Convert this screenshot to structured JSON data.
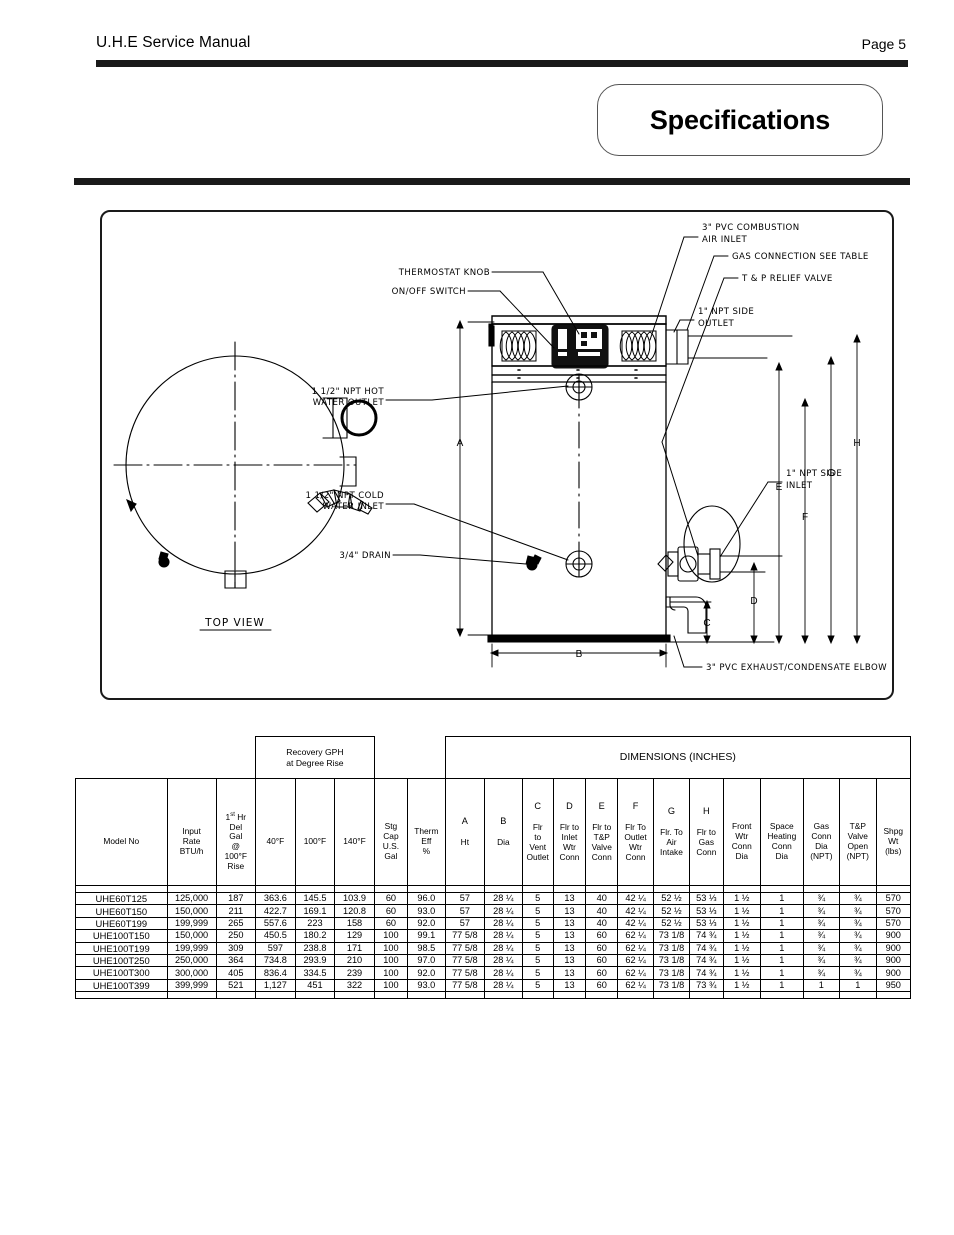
{
  "header": {
    "manual_title": "U.H.E Service Manual",
    "page_number": "Page 5",
    "section_badge": "Specifications"
  },
  "diagram": {
    "top_view_label": "TOP VIEW",
    "callouts": {
      "thermostat_knob": "THERMOSTAT KNOB",
      "on_off_switch": "ON/OFF SWITCH",
      "pvc_combustion_air_inlet_line1": "3\" PVC COMBUSTION",
      "pvc_combustion_air_inlet_line2": "AIR INLET",
      "gas_connection": "GAS CONNECTION SEE TABLE",
      "tp_relief_valve": "T & P RELIEF VALVE",
      "npt_side_outlet_line1": "1\" NPT SIDE",
      "npt_side_outlet_line2": "OUTLET",
      "npt_hot_water_outlet_line1": "1 1/2\" NPT HOT",
      "npt_hot_water_outlet_line2": "WATER OUTLET",
      "npt_cold_water_inlet_line1": "1 1/2\" NPT COLD",
      "npt_cold_water_inlet_line2": "WATER INLET",
      "drain": "3/4\" DRAIN",
      "npt_side_inlet_line1": "1\" NPT SIDE",
      "npt_side_inlet_line2": "INLET",
      "pvc_exhaust_elbow": "3\" PVC EXHAUST/CONDENSATE ELBOW"
    },
    "dimension_letters": [
      "A",
      "B",
      "C",
      "D",
      "E",
      "F",
      "G",
      "H"
    ]
  },
  "table": {
    "group_headers": {
      "recovery_line1": "Recovery GPH",
      "recovery_line2": "at Degree Rise",
      "dimensions": "DIMENSIONS (INCHES)"
    },
    "columns": [
      {
        "letter": "",
        "lines": [
          "Model No"
        ]
      },
      {
        "letter": "",
        "lines": [
          "Input",
          "Rate",
          "BTU/h"
        ]
      },
      {
        "letter": "",
        "lines": [
          "1st Hr",
          "Del",
          "Gal",
          "@",
          "100°F",
          "Rise"
        ],
        "sup": "st"
      },
      {
        "letter": "",
        "lines": [
          "40°F"
        ]
      },
      {
        "letter": "",
        "lines": [
          "100°F"
        ]
      },
      {
        "letter": "",
        "lines": [
          "140°F"
        ]
      },
      {
        "letter": "",
        "lines": [
          "Stg",
          "Cap",
          "U.S.",
          "Gal"
        ]
      },
      {
        "letter": "",
        "lines": [
          "Therm",
          "Eff",
          "%"
        ]
      },
      {
        "letter": "A",
        "lines": [
          "Ht"
        ]
      },
      {
        "letter": "B",
        "lines": [
          "Dia"
        ]
      },
      {
        "letter": "C",
        "lines": [
          "Flr",
          "to",
          "Vent",
          "Outlet"
        ]
      },
      {
        "letter": "D",
        "lines": [
          "Flr to",
          "Inlet",
          "Wtr",
          "Conn"
        ]
      },
      {
        "letter": "E",
        "lines": [
          "Flr to",
          "T&P",
          "Valve",
          "Conn"
        ]
      },
      {
        "letter": "F",
        "lines": [
          "Flr To",
          "Outlet",
          "Wtr",
          "Conn"
        ]
      },
      {
        "letter": "G",
        "lines": [
          "Flr. To",
          "Air",
          "Intake"
        ]
      },
      {
        "letter": "H",
        "lines": [
          "Flr to",
          "Gas",
          "Conn"
        ]
      },
      {
        "letter": "",
        "lines": [
          "Front",
          "Wtr",
          "Conn",
          "Dia"
        ]
      },
      {
        "letter": "",
        "lines": [
          "Space",
          "Heating",
          "Conn",
          "Dia"
        ]
      },
      {
        "letter": "",
        "lines": [
          "Gas",
          "Conn",
          "Dia",
          "(NPT)"
        ]
      },
      {
        "letter": "",
        "lines": [
          "T&P",
          "Valve",
          "Open",
          "(NPT)"
        ]
      },
      {
        "letter": "",
        "lines": [
          "Shpg",
          "Wt",
          "(lbs)"
        ]
      }
    ],
    "rows": [
      [
        "UHE60T125",
        "125,000",
        "187",
        "363.6",
        "145.5",
        "103.9",
        "60",
        "96.0",
        "57",
        "28 ¼",
        "5",
        "13",
        "40",
        "42 ¼",
        "52 ½",
        "53 ⅓",
        "1 ½",
        "1",
        "¾",
        "¾",
        "570"
      ],
      [
        "UHE60T150",
        "150,000",
        "211",
        "422.7",
        "169.1",
        "120.8",
        "60",
        "93.0",
        "57",
        "28 ¼",
        "5",
        "13",
        "40",
        "42 ¼",
        "52 ½",
        "53 ⅓",
        "1 ½",
        "1",
        "¾",
        "¾",
        "570"
      ],
      [
        "UHE60T199",
        "199,999",
        "265",
        "557.6",
        "223",
        "158",
        "60",
        "92.0",
        "57",
        "28 ¼",
        "5",
        "13",
        "40",
        "42 ¼",
        "52 ½",
        "53 ⅓",
        "1 ½",
        "1",
        "¾",
        "¾",
        "570"
      ],
      [
        "UHE100T150",
        "150,000",
        "250",
        "450.5",
        "180.2",
        "129",
        "100",
        "99.1",
        "77 5/8",
        "28 ¼",
        "5",
        "13",
        "60",
        "62 ¼",
        "73 1/8",
        "74 ¾",
        "1 ½",
        "1",
        "¾",
        "¾",
        "900"
      ],
      [
        "UHE100T199",
        "199,999",
        "309",
        "597",
        "238.8",
        "171",
        "100",
        "98.5",
        "77 5/8",
        "28 ¼",
        "5",
        "13",
        "60",
        "62 ¼",
        "73 1/8",
        "74 ¾",
        "1 ½",
        "1",
        "¾",
        "¾",
        "900"
      ],
      [
        "UHE100T250",
        "250,000",
        "364",
        "734.8",
        "293.9",
        "210",
        "100",
        "97.0",
        "77 5/8",
        "28 ¼",
        "5",
        "13",
        "60",
        "62 ¼",
        "73 1/8",
        "74 ¾",
        "1 ½",
        "1",
        "¾",
        "¾",
        "900"
      ],
      [
        "UHE100T300",
        "300,000",
        "405",
        "836.4",
        "334.5",
        "239",
        "100",
        "92.0",
        "77 5/8",
        "28 ¼",
        "5",
        "13",
        "60",
        "62 ¼",
        "73 1/8",
        "74 ¾",
        "1 ½",
        "1",
        "¾",
        "¾",
        "900"
      ],
      [
        "UHE100T399",
        "399,999",
        "521",
        "1,127",
        "451",
        "322",
        "100",
        "93.0",
        "77 5/8",
        "28 ¼",
        "5",
        "13",
        "60",
        "62 ¼",
        "73 1/8",
        "73 ¾",
        "1 ½",
        "1",
        "1",
        "1",
        "950"
      ]
    ]
  }
}
